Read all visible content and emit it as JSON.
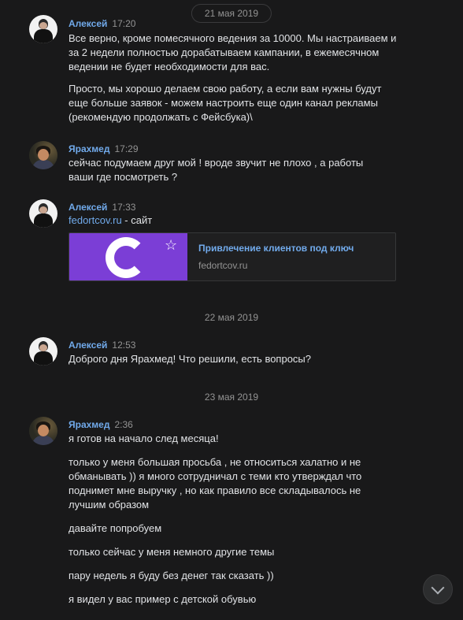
{
  "dates": {
    "d1": "21 мая 2019",
    "d2": "22 мая 2019",
    "d3": "23 мая 2019"
  },
  "messages": [
    {
      "author": "Алексей",
      "time": "17:20",
      "paragraphs": [
        "Все верно, кроме помесячного ведения за 10000. Мы настраиваем и за 2 недели полностью дорабатываем кампании, в ежемесячном ведении не будет необходимости для вас.",
        "Просто, мы хорошо делаем свою работу, а если вам нужны будут еще больше заявок - можем настроить еще один канал рекламы (рекомендую продолжать с Фейсбука)\\"
      ]
    },
    {
      "author": "Ярахмед",
      "time": "17:29",
      "paragraphs": [
        "сейчас подумаем друг мой ! вроде звучит не плохо , а работы ваши где посмотреть ?"
      ]
    },
    {
      "author": "Алексей",
      "time": "17:33",
      "link_text": "fedortcov.ru",
      "link_suffix": " - сайт",
      "card": {
        "title": "Привлечение клиентов под ключ",
        "domain": "fedortcov.ru"
      }
    },
    {
      "author": "Алексей",
      "time": "12:53",
      "paragraphs": [
        "Доброго дня Ярахмед! Что решили, есть вопросы?"
      ]
    },
    {
      "author": "Ярахмед",
      "time": "2:36",
      "paragraphs": [
        "я готов на начало след месяца!",
        "только у меня большая просьба , не относиться халатно и не обманывать )) я много сотрудничал с теми кто утверждал что поднимет мне выручку , но как правило все складывалось не лучшим образом",
        "давайте попробуем",
        "только сейчас у меня немного другие темы",
        "пару недель я буду без денег так сказать ))",
        "я видел у вас пример с детской обувью"
      ]
    }
  ],
  "icons": {
    "scroll_down": "chevron-down-icon",
    "favorite": "star-outline-icon"
  }
}
